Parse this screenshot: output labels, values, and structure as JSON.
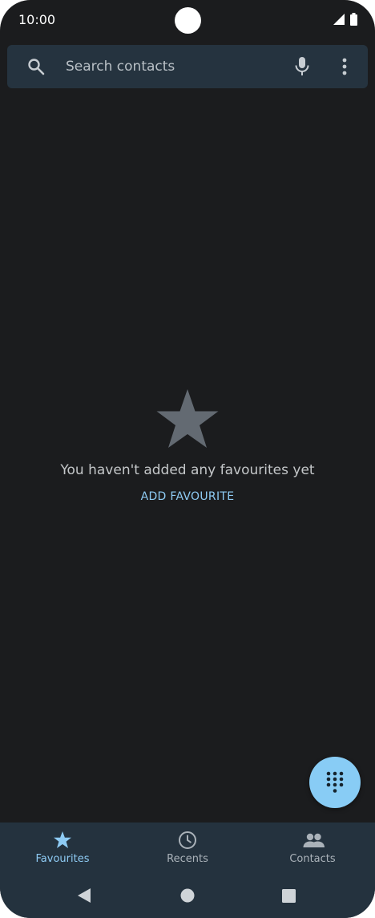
{
  "status": {
    "time": "10:00"
  },
  "search": {
    "placeholder": "Search contacts"
  },
  "empty_state": {
    "message": "You haven't added any favourites yet",
    "action_label": "ADD FAVOURITE"
  },
  "bottom_nav": {
    "items": [
      {
        "label": "Favourites",
        "icon": "star-icon",
        "active": true
      },
      {
        "label": "Recents",
        "icon": "clock-icon",
        "active": false
      },
      {
        "label": "Contacts",
        "icon": "people-icon",
        "active": false
      }
    ]
  },
  "colors": {
    "background": "#1b1c1e",
    "surface": "#25333f",
    "accent": "#8ecbf4",
    "fab": "#88ccf5"
  }
}
